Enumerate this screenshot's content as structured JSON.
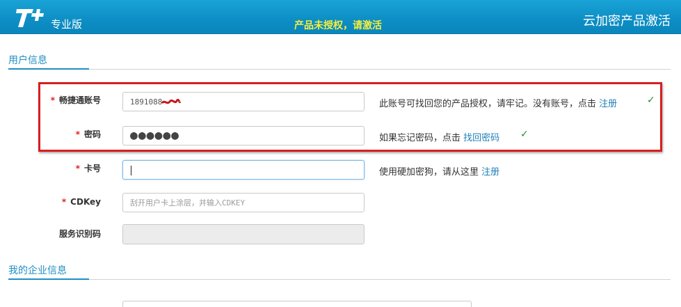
{
  "header": {
    "logo_text": "T+",
    "edition": "专业版",
    "notice": "产品未授权，请激活",
    "title": "云加密产品激活"
  },
  "sections": {
    "user_info": "用户信息",
    "company_info": "我的企业信息"
  },
  "form": {
    "account": {
      "label": "畅捷通账号",
      "value": "1891088",
      "hint_text": "此账号可找回您的产品授权，请牢记。没有账号，点击",
      "hint_link": "注册"
    },
    "password": {
      "label": "密码",
      "value": "●●●●●●",
      "hint_text": "如果忘记密码，点击",
      "hint_link": "找回密码"
    },
    "card": {
      "label": "卡号",
      "value": "",
      "hint_text": "使用硬加密狗，请从这里",
      "hint_link": "注册"
    },
    "cdkey": {
      "label": "CDKey",
      "placeholder": "刮开用户卡上涂层，并输入CDKEY"
    },
    "service_code": {
      "label": "服务识别码",
      "value": ""
    }
  },
  "marks": {
    "required": "*",
    "check": "✓"
  },
  "colors": {
    "header": "#0d8ec4",
    "notice": "#f6ef3c",
    "accent": "#1e8fc3",
    "highlight_box": "#d81e1e"
  }
}
